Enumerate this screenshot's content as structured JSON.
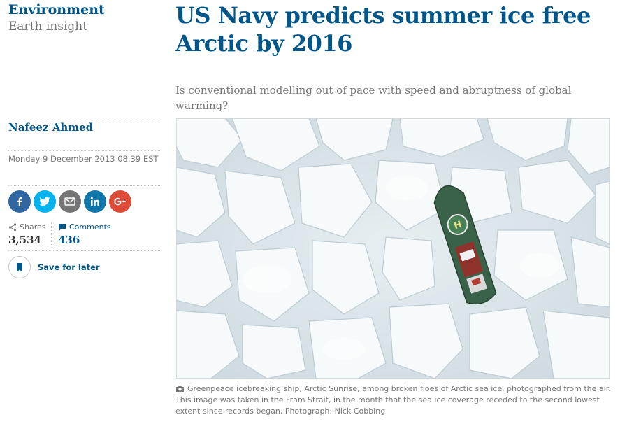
{
  "section": {
    "title": "Environment",
    "series": "Earth insight"
  },
  "byline": {
    "author": "Nafeez Ahmed",
    "date": "Monday 9 December 2013 08.39 EST"
  },
  "share": {
    "buttons": [
      "facebook-icon",
      "twitter-icon",
      "email-icon",
      "linkedin-icon",
      "google-plus-icon"
    ],
    "shares_label": "Shares",
    "shares_count": "3,534",
    "comments_label": "Comments",
    "comments_count": "436",
    "save_label": "Save for later"
  },
  "article": {
    "headline": "US Navy predicts summer ice free Arctic by 2016",
    "standfirst": "Is conventional modelling out of pace with speed and abruptness of global warming?",
    "image_caption": "Greenpeace icebreaking ship, Arctic Sunrise, among broken floes of Arctic sea ice, photographed from the air. This image was taken in the Fram Strait, in the month that the sea ice coverage receded to the second lowest extent since records began. Photograph: Nick Cobbing"
  },
  "colors": {
    "brand_blue": "#005689",
    "facebook": "#3067a3",
    "twitter": "#03b3ee",
    "email": "#767676",
    "linkedin": "#0e76a8",
    "google_plus": "#dd4b39",
    "ship_hull": "#2f5a3f",
    "helipad": "#3f7b4e"
  }
}
